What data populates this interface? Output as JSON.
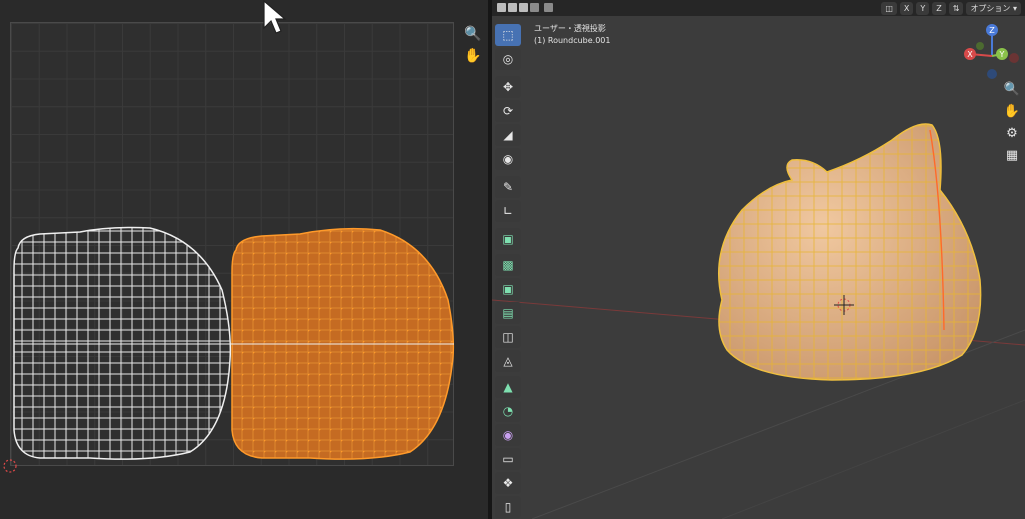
{
  "uv_editor": {
    "nav_icons": [
      "zoom-icon",
      "hand-icon"
    ]
  },
  "viewport": {
    "header": {
      "axis_x": "X",
      "axis_y": "Y",
      "axis_z": "Z",
      "options_label": "オプション"
    },
    "view_name": "ユーザー・透視投影",
    "object_name": "(1) Roundcube.001",
    "gizmo": {
      "z": "Z",
      "x": "X",
      "y": "Y"
    },
    "tools": [
      "select-box",
      "cursor",
      "move",
      "rotate",
      "scale",
      "transform",
      "annotate",
      "measure",
      "add-cube",
      "extrude",
      "inset",
      "bevel",
      "loop-cut",
      "knife",
      "poly-build",
      "spin",
      "smooth",
      "shrink-fatten",
      "shear",
      "rip"
    ],
    "colors": {
      "selected_orange": "#e07a1f",
      "wire_white": "#e8e8e8",
      "model_skin": "#e2b48a",
      "active_tool": "#4772b3"
    }
  }
}
